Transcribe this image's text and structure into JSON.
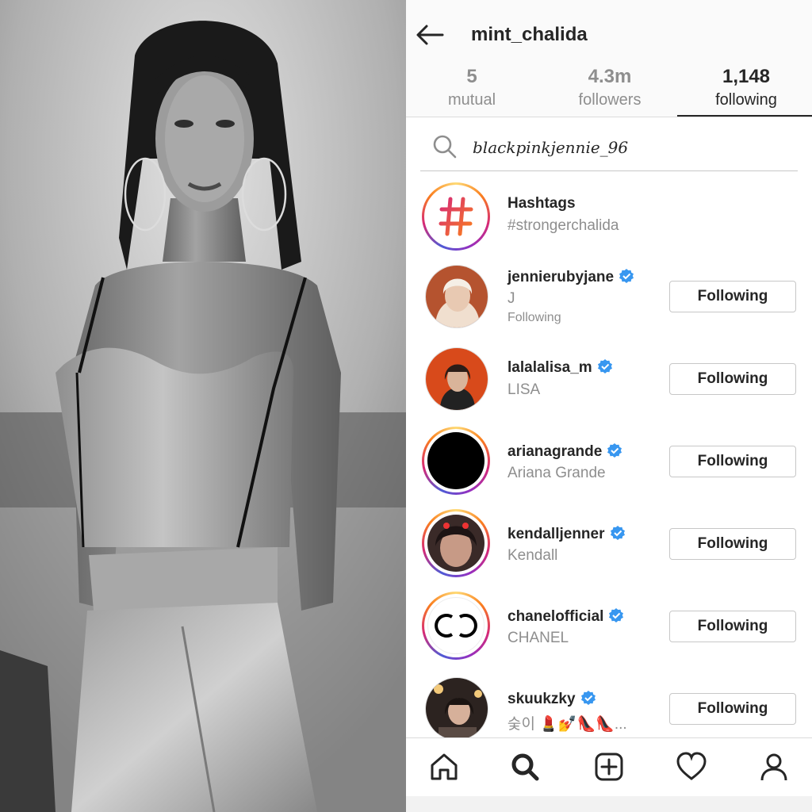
{
  "header": {
    "username": "mint_chalida"
  },
  "tabs": [
    {
      "count": "5",
      "label": "mutual",
      "active": false
    },
    {
      "count": "4.3m",
      "label": "followers",
      "active": false
    },
    {
      "count": "1,148",
      "label": "following",
      "active": true
    }
  ],
  "search": {
    "value": "blackpinkjennie_96"
  },
  "hashtags": {
    "title": "Hashtags",
    "tag": "#strongerchalida"
  },
  "accounts": [
    {
      "username": "jennierubyjane",
      "verified": true,
      "name": "J",
      "note": "Following",
      "button": "Following"
    },
    {
      "username": "lalalalisa_m",
      "verified": true,
      "name": "LISA",
      "button": "Following"
    },
    {
      "username": "arianagrande",
      "verified": true,
      "name": "Ariana Grande",
      "button": "Following"
    },
    {
      "username": "kendalljenner",
      "verified": true,
      "name": "Kendall",
      "button": "Following"
    },
    {
      "username": "chanelofficial",
      "verified": true,
      "name": "CHANEL",
      "button": "Following"
    },
    {
      "username": "skuukzky",
      "verified": true,
      "name": "숮이 💄💅👠👠...",
      "button": "Following"
    }
  ],
  "nav": [
    "home-icon",
    "search-icon",
    "add-post-icon",
    "heart-icon",
    "profile-icon"
  ],
  "colors": {
    "verified_blue": "#3897f0",
    "text_primary": "#262626",
    "text_secondary": "#8e8e8e"
  }
}
